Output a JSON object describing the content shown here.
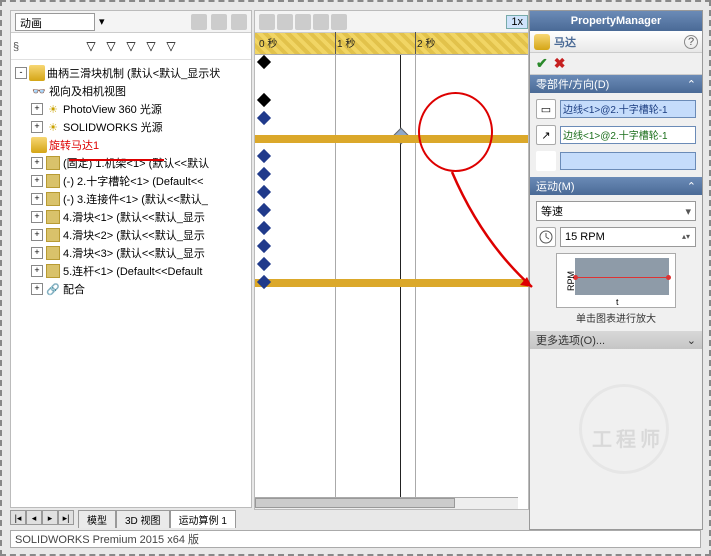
{
  "anim_combo": "动画",
  "timeline_speed": "1x",
  "ruler": {
    "zero": "0 秒",
    "one": "1 秒",
    "two": "2 秒"
  },
  "tree": {
    "root": "曲柄三滑块机制  (默认<默认_显示状",
    "views": "视向及相机视图",
    "pv360": "PhotoView 360 光源",
    "swlights": "SOLIDWORKS 光源",
    "motor": "旋转马达1",
    "item1": "(固定) 1.机架<1> (默认<<默认",
    "item2": "(-) 2.十字槽轮<1> (Default<<",
    "item3": "(-) 3.连接件<1> (默认<<默认_",
    "item4": "4.滑块<1> (默认<<默认_显示",
    "item5": "4.滑块<2> (默认<<默认_显示",
    "item6": "4.滑块<3> (默认<<默认_显示",
    "item7": "5.连杆<1> (Default<<Default",
    "mates": "配合"
  },
  "pm": {
    "header": "PropertyManager",
    "title": "马达",
    "sec_comp": "零部件/方向(D)",
    "edge1": "边线<1>@2.十字槽轮-1",
    "edge2": "边线<1>@2.十字槽轮-1",
    "sec_motion": "运动(M)",
    "speed_type": "等速",
    "speed_value": "15 RPM",
    "graph_y": "RPM",
    "graph_x": "t",
    "graph_caption": "单击图表进行放大",
    "sec_more": "更多选项(O)..."
  },
  "tabs": {
    "model": "模型",
    "view3d": "3D 视图",
    "motion1": "运动算例 1"
  },
  "status": "SOLIDWORKS Premium 2015 x64 版",
  "watermark": "工程师"
}
